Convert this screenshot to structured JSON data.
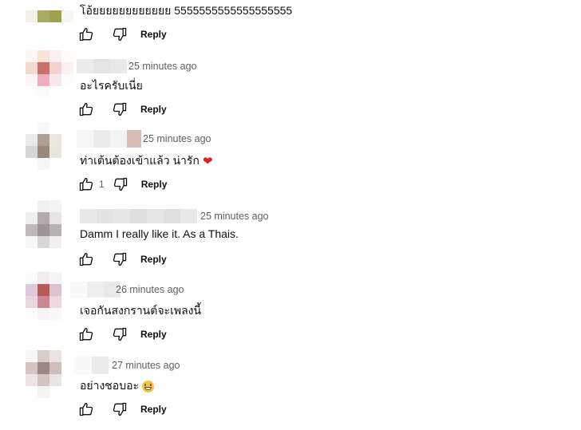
{
  "comments": [
    {
      "text": "โอ้ยยยยยยยยยยยย 5555555555555555555",
      "likes": "",
      "reply_label": "Reply",
      "avatar_colors": [
        "#f1f1ea",
        "#a9ab62",
        "#9ea04e",
        "#f7f7f2"
      ]
    },
    {
      "author_time": "25 minutes ago",
      "text": "อะไรครับเนี่ย",
      "likes": "",
      "reply_label": "Reply",
      "avatar_colors": [
        "#fdf7f5",
        "#f9e2d6",
        "#fbf0ec",
        "#fefcfb",
        "#f4d9cc",
        "#c8716a",
        "#f1d2cd",
        "#fbf2f0",
        "#fcf5f6",
        "#efadbd",
        "#f9e7ec",
        "#fefcfc",
        "#ffffff",
        "#fdfafa",
        "#ffffff",
        "#ffffff"
      ]
    },
    {
      "author_time": "25 minutes ago",
      "text": "ท่าเต้นต้องเข้าแล้ว น่ารัก",
      "emoji": "heart",
      "likes": "1",
      "reply_label": "Reply",
      "avatar_colors": [
        "#ffffff",
        "#f8f8f8",
        "#ffffff",
        "#ffffff",
        "#eaeaea",
        "#ad9f94",
        "#ece8e0",
        "#ffffff",
        "#d6d6d6",
        "#9a887d",
        "#e8e4de",
        "#ffffff",
        "#ffffff",
        "#f6f6f6",
        "#ffffff",
        "#ffffff"
      ]
    },
    {
      "author_time": "25 minutes ago",
      "text": "Damm I really like it. As a Thais.",
      "likes": "",
      "reply_label": "Reply",
      "avatar_colors": [
        "#ffffff",
        "#f0f0f0",
        "#f4f4f4",
        "#ffffff",
        "#efefef",
        "#b2abad",
        "#e6e4e6",
        "#ffffff",
        "#bfb8bb",
        "#9d9597",
        "#b7b0b3",
        "#ffffff",
        "#f7f7f7",
        "#d9d5d8",
        "#efeff0",
        "#ffffff"
      ]
    },
    {
      "author_time": "26 minutes ago",
      "text": "เจอกันสงกรานต์จะเพลงนี้",
      "likes": "",
      "reply_label": "Reply",
      "avatar_colors": [
        "#fbfbfb",
        "#f2ecef",
        "#f7f4f6",
        "#ffffff",
        "#dcc9dc",
        "#b75a58",
        "#ddc3cf",
        "#ffffff",
        "#e8d6df",
        "#cb8891",
        "#eed9df",
        "#ffffff",
        "#fdfdfd",
        "#f8f3f5",
        "#fbf8f9",
        "#ffffff"
      ]
    },
    {
      "author_time": "27 minutes ago",
      "text": "อย่างชอบอะ",
      "emoji": "grin",
      "likes": "",
      "reply_label": "Reply",
      "avatar_colors": [
        "#f7f7f7",
        "#d8ccc9",
        "#e8e2e0",
        "#ffffff",
        "#d3c6c2",
        "#9e8782",
        "#cdbeb9",
        "#ffffff",
        "#ebe6e4",
        "#d3c6c2",
        "#eae4e2",
        "#ffffff",
        "#ffffff",
        "#f6f4f3",
        "#ffffff",
        "#ffffff"
      ]
    }
  ]
}
